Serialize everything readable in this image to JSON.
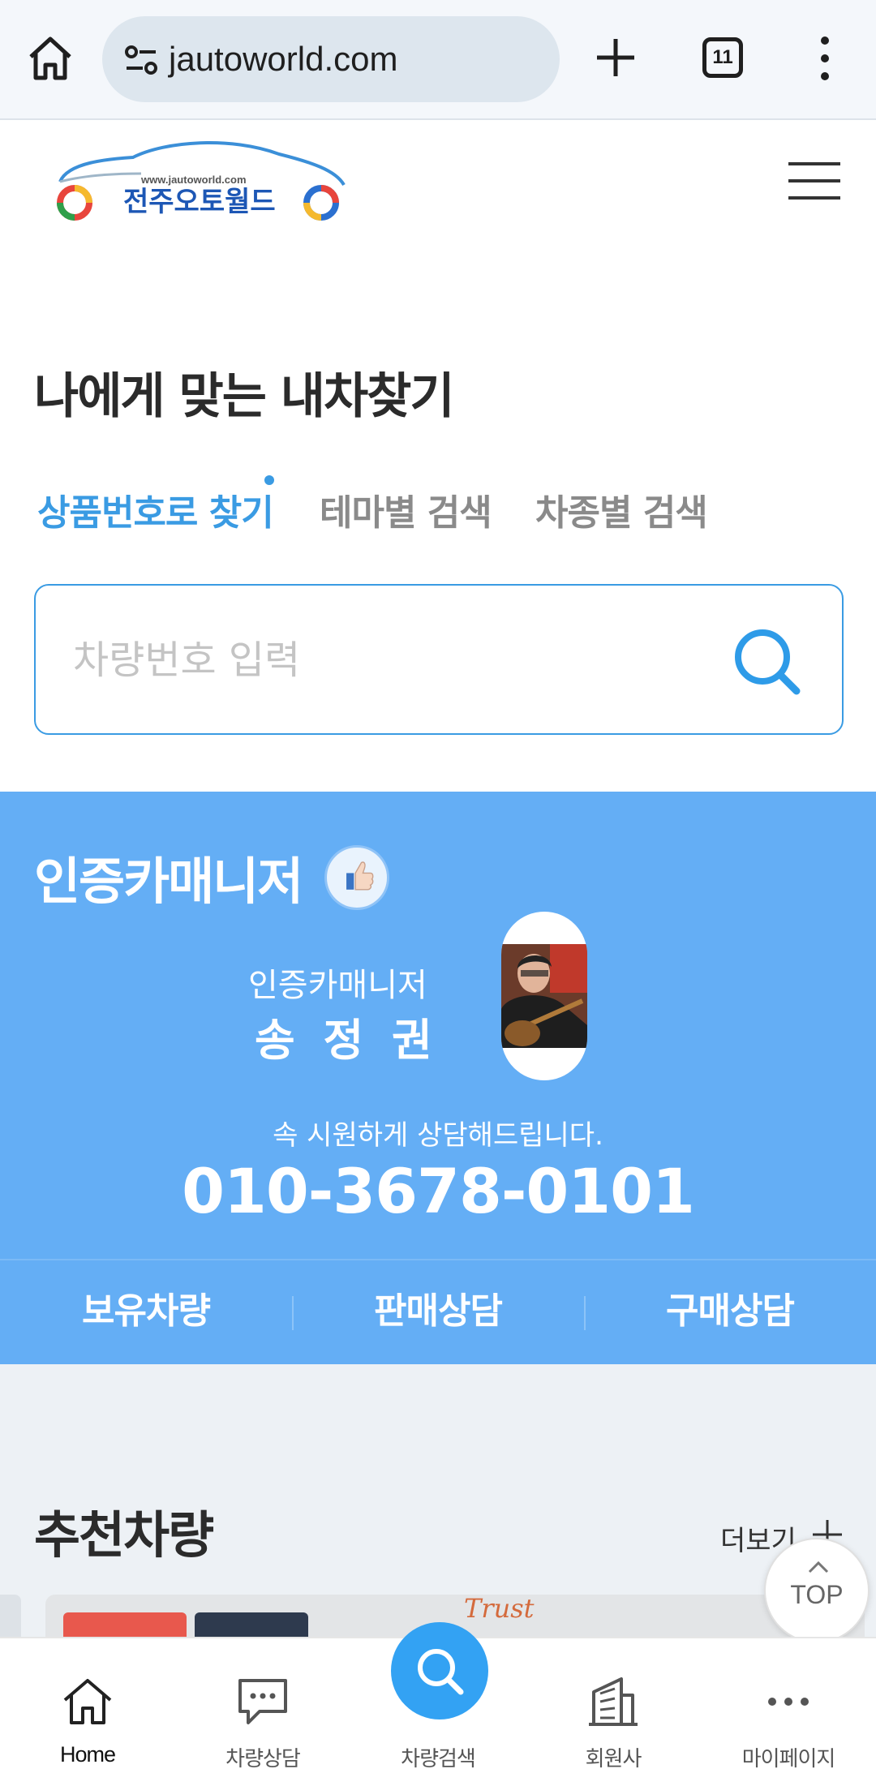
{
  "browser": {
    "url": "jautoworld.com",
    "tab_count": "11"
  },
  "header": {
    "logo_url_text": "www.jautoworld.com",
    "logo_name": "전주오토월드"
  },
  "find": {
    "title": "나에게 맞는 내차찾기",
    "tabs": [
      {
        "label": "상품번호로 찾기",
        "active": true
      },
      {
        "label": "테마별 검색",
        "active": false
      },
      {
        "label": "차종별 검색",
        "active": false
      }
    ],
    "search_placeholder": "차량번호 입력"
  },
  "cert": {
    "title": "인증카매니저",
    "manager_role": "인증카매니저",
    "manager_name": "송 정 권",
    "note": "속 시원하게 상담해드립니다.",
    "phone": "010-3678-0101",
    "links": [
      "보유차량",
      "판매상담",
      "구매상담"
    ]
  },
  "recommend": {
    "title": "추천차량",
    "more_label": "더보기",
    "card_text": "Trust"
  },
  "top_button": "TOP",
  "bottom_nav": [
    {
      "label": "Home",
      "icon": "home-icon"
    },
    {
      "label": "차량상담",
      "icon": "chat-icon"
    },
    {
      "label": "차량검색",
      "icon": "search-icon"
    },
    {
      "label": "회원사",
      "icon": "building-icon"
    },
    {
      "label": "마이페이지",
      "icon": "more-icon"
    }
  ],
  "colors": {
    "accent": "#3a9be3",
    "cert_bg": "#64aef5",
    "nav_center": "#33a2f3"
  }
}
